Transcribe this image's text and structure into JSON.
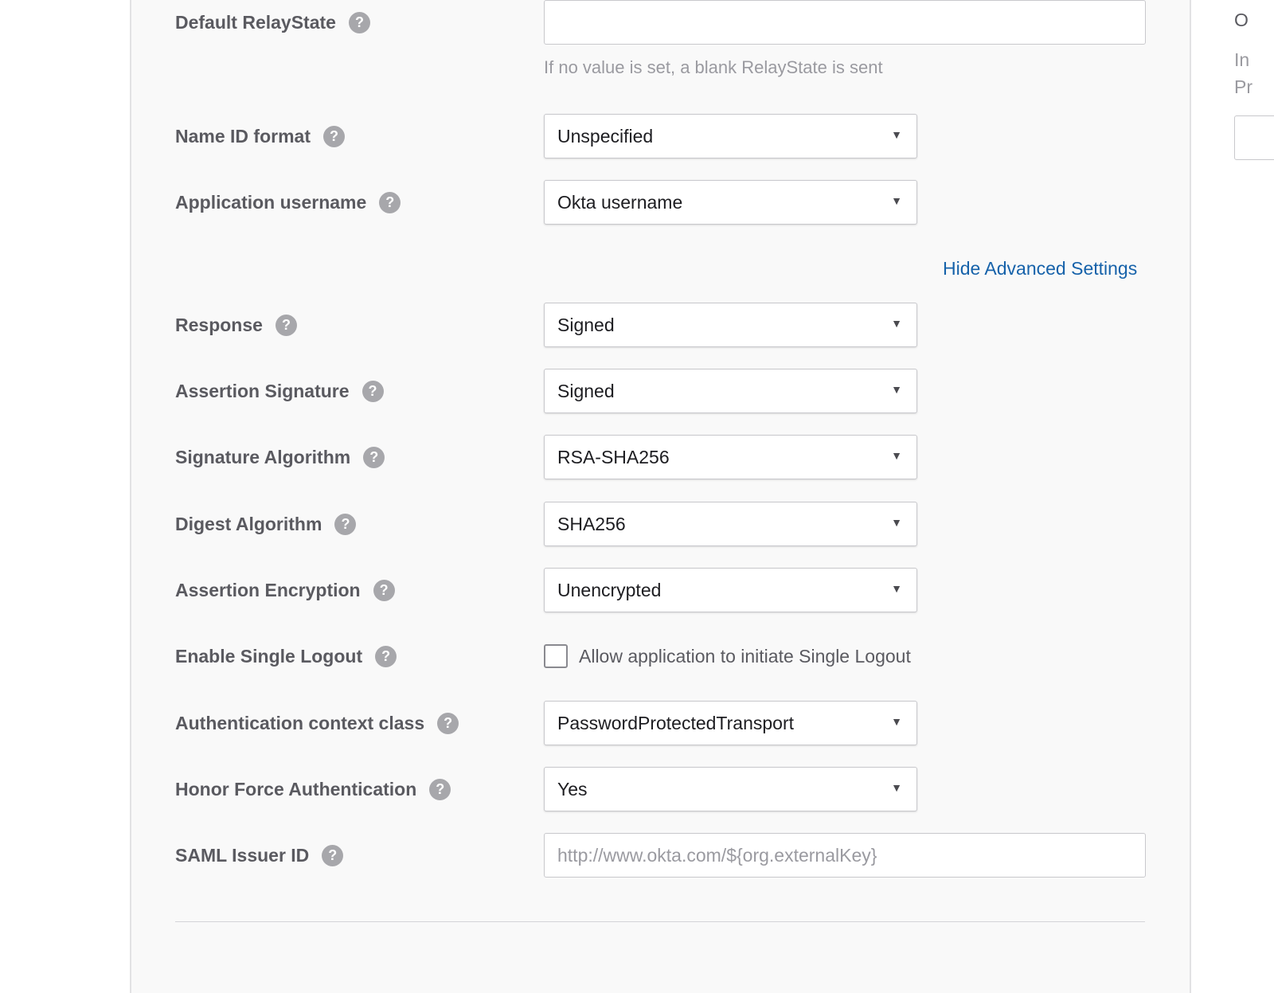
{
  "fields": {
    "default_relaystate": {
      "label": "Default RelayState",
      "value": "",
      "hint": "If no value is set, a blank RelayState is sent"
    },
    "name_id_format": {
      "label": "Name ID format",
      "value": "Unspecified"
    },
    "application_username": {
      "label": "Application username",
      "value": "Okta username"
    },
    "response": {
      "label": "Response",
      "value": "Signed"
    },
    "assertion_signature": {
      "label": "Assertion Signature",
      "value": "Signed"
    },
    "signature_algorithm": {
      "label": "Signature Algorithm",
      "value": "RSA-SHA256"
    },
    "digest_algorithm": {
      "label": "Digest Algorithm",
      "value": "SHA256"
    },
    "assertion_encryption": {
      "label": "Assertion Encryption",
      "value": "Unencrypted"
    },
    "enable_single_logout": {
      "label": "Enable Single Logout",
      "checkbox_label": "Allow application to initiate Single Logout",
      "checked": false
    },
    "authentication_context_class": {
      "label": "Authentication context class",
      "value": "PasswordProtectedTransport"
    },
    "honor_force_authentication": {
      "label": "Honor Force Authentication",
      "value": "Yes"
    },
    "saml_issuer_id": {
      "label": "SAML Issuer ID",
      "placeholder": "http://www.okta.com/${org.externalKey}"
    }
  },
  "advanced_link": "Hide Advanced Settings",
  "help_glyph": "?",
  "caret_glyph": "▼",
  "right_panel": {
    "line1": "O",
    "line2": "In",
    "line3": "Pr"
  },
  "colors": {
    "link": "#1662aa",
    "help_bg": "#a7a7ab",
    "panel_bg": "#f9f9f9"
  }
}
